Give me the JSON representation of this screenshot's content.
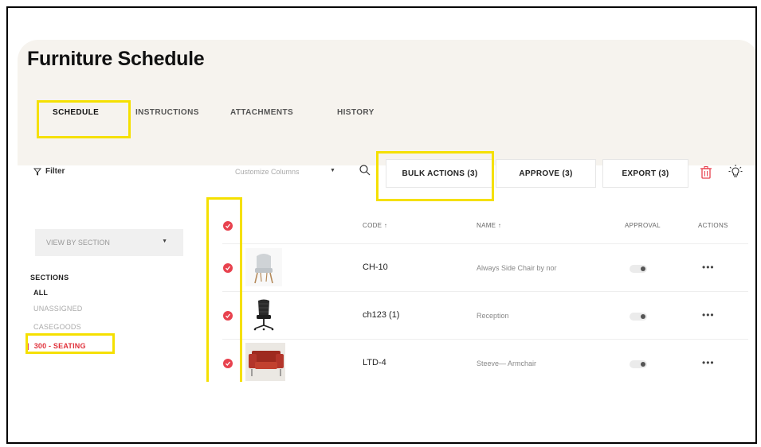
{
  "page": {
    "title": "Furniture Schedule"
  },
  "tabs": [
    {
      "label": "SCHEDULE",
      "active": true
    },
    {
      "label": "INSTRUCTIONS"
    },
    {
      "label": "ATTACHMENTS"
    },
    {
      "label": "HISTORY"
    }
  ],
  "toolbar": {
    "filter_label": "Filter",
    "customize_columns": "Customize Columns",
    "bulk_actions": "BULK ACTIONS (3)",
    "approve": "APPROVE (3)",
    "export": "EXPORT (3)"
  },
  "sidebar": {
    "view_by": "VIEW BY SECTION",
    "sections_title": "SECTIONS",
    "items": [
      {
        "label": "ALL"
      },
      {
        "label": "UNASSIGNED"
      },
      {
        "label": "CASEGOODS"
      },
      {
        "label": "300 - SEATING",
        "active": true
      }
    ]
  },
  "table": {
    "columns": [
      "CODE ↑",
      "NAME ↑",
      "APPROVAL",
      "ACTIONS"
    ],
    "rows": [
      {
        "code": "CH-10",
        "name": "Always Side Chair by nor",
        "approved": false,
        "selected": true,
        "thumb": "side-chair"
      },
      {
        "code": "ch123 (1)",
        "name": "Reception",
        "approved": false,
        "selected": true,
        "thumb": "office-chair"
      },
      {
        "code": "LTD-4",
        "name": "Steeve— Armchair",
        "approved": false,
        "selected": true,
        "thumb": "armchair"
      }
    ],
    "actions_symbol": "•••"
  },
  "colors": {
    "accent_red": "#e8424e",
    "highlight_yellow": "#f5e000",
    "header_bg": "#f6f3ee"
  },
  "icons": [
    "filter-icon",
    "search-icon",
    "trash-icon",
    "lightbulb-icon",
    "check-icon",
    "caret-down-icon",
    "more-icon"
  ]
}
